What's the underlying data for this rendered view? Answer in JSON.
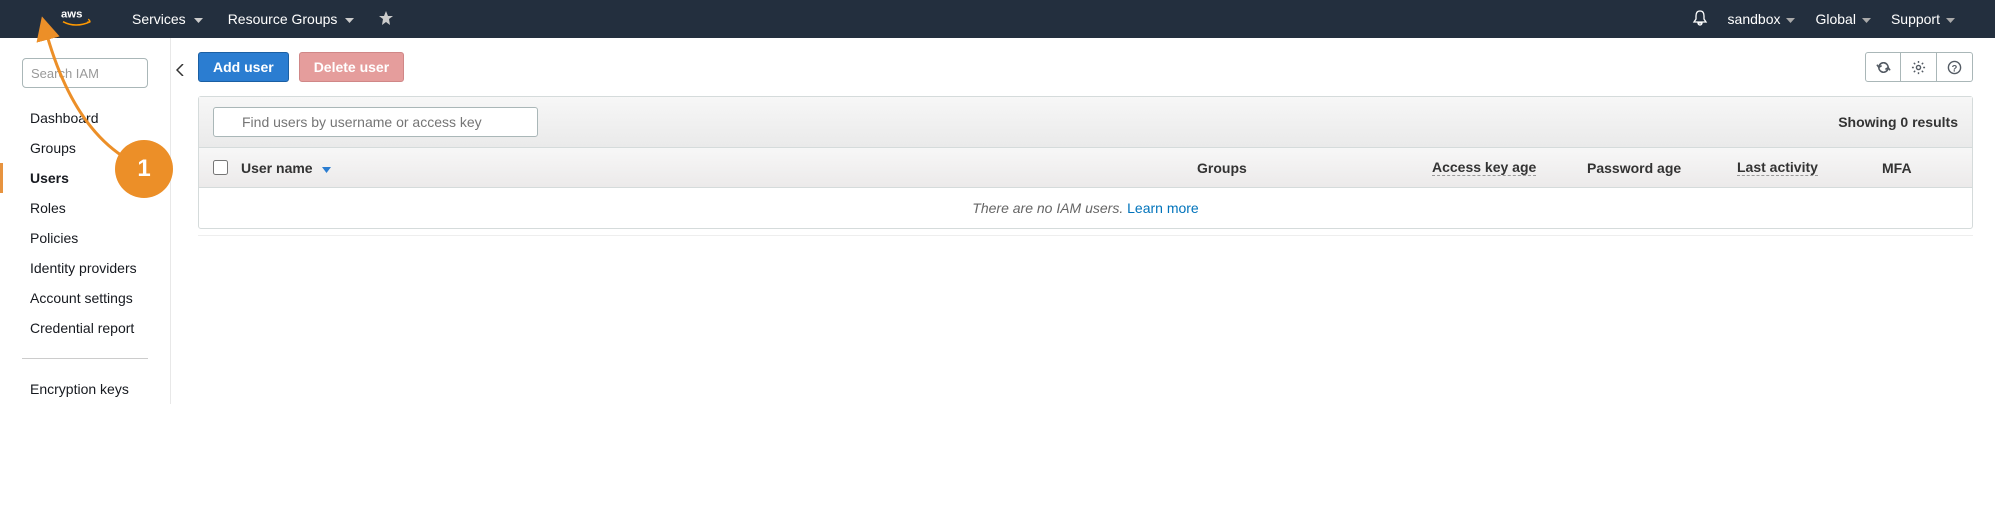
{
  "topnav": {
    "services": "Services",
    "resource_groups": "Resource Groups",
    "account": "sandbox",
    "region": "Global",
    "support": "Support"
  },
  "sidebar": {
    "search_placeholder": "Search IAM",
    "items": [
      {
        "label": "Dashboard"
      },
      {
        "label": "Groups"
      },
      {
        "label": "Users",
        "active": true
      },
      {
        "label": "Roles"
      },
      {
        "label": "Policies"
      },
      {
        "label": "Identity providers"
      },
      {
        "label": "Account settings"
      },
      {
        "label": "Credential report"
      }
    ],
    "encryption": "Encryption keys"
  },
  "actions": {
    "add_user": "Add user",
    "delete_user": "Delete user"
  },
  "filter": {
    "placeholder": "Find users by username or access key",
    "results_text": "Showing 0 results"
  },
  "table": {
    "columns": {
      "username": "User name",
      "groups": "Groups",
      "access_key_age": "Access key age",
      "password_age": "Password age",
      "last_activity": "Last activity",
      "mfa": "MFA"
    },
    "empty_text": "There are no IAM users. ",
    "learn_more": "Learn more"
  },
  "annotation": {
    "label": "1"
  }
}
